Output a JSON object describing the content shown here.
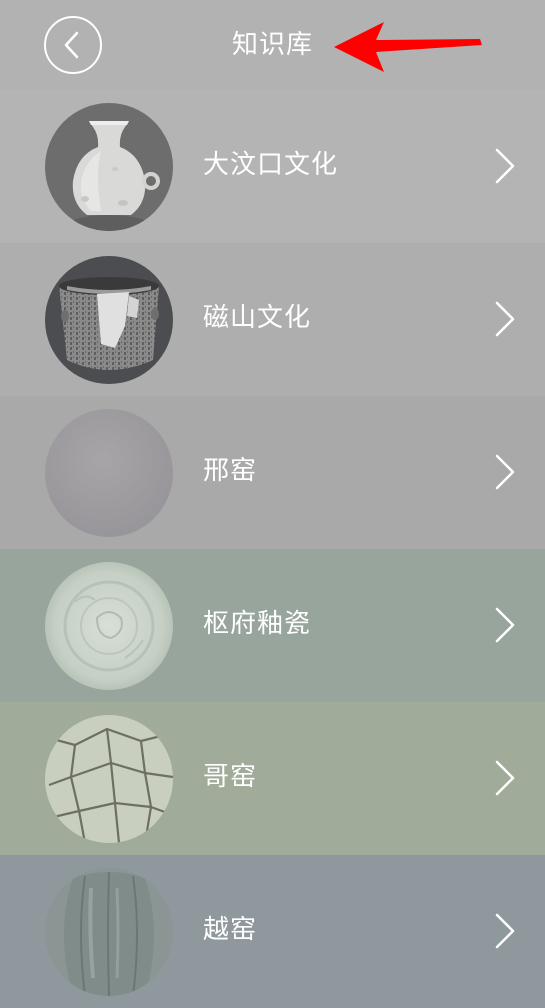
{
  "header": {
    "title": "知识库",
    "back_icon": "chevron-left-icon"
  },
  "annotation": {
    "icon": "red-arrow-icon",
    "color": "#ff0000"
  },
  "items": [
    {
      "label": "大汶口文化",
      "bg": "#b4b4b4",
      "thumbnail": "white-pottery-vase"
    },
    {
      "label": "磁山文化",
      "bg": "#aeaeae",
      "thumbnail": "gray-pottery-bowl"
    },
    {
      "label": "邢窑",
      "bg": "#a9a9a9",
      "thumbnail": "white-porcelain-surface"
    },
    {
      "label": "枢府釉瓷",
      "bg": "#97a59c",
      "thumbnail": "celadon-plate-center"
    },
    {
      "label": "哥窑",
      "bg": "#a1ab9a",
      "thumbnail": "crackle-glaze-surface"
    },
    {
      "label": "越窑",
      "bg": "#8f989d",
      "thumbnail": "lobed-celadon-vessel"
    }
  ],
  "chevron_icon": "chevron-right-icon"
}
